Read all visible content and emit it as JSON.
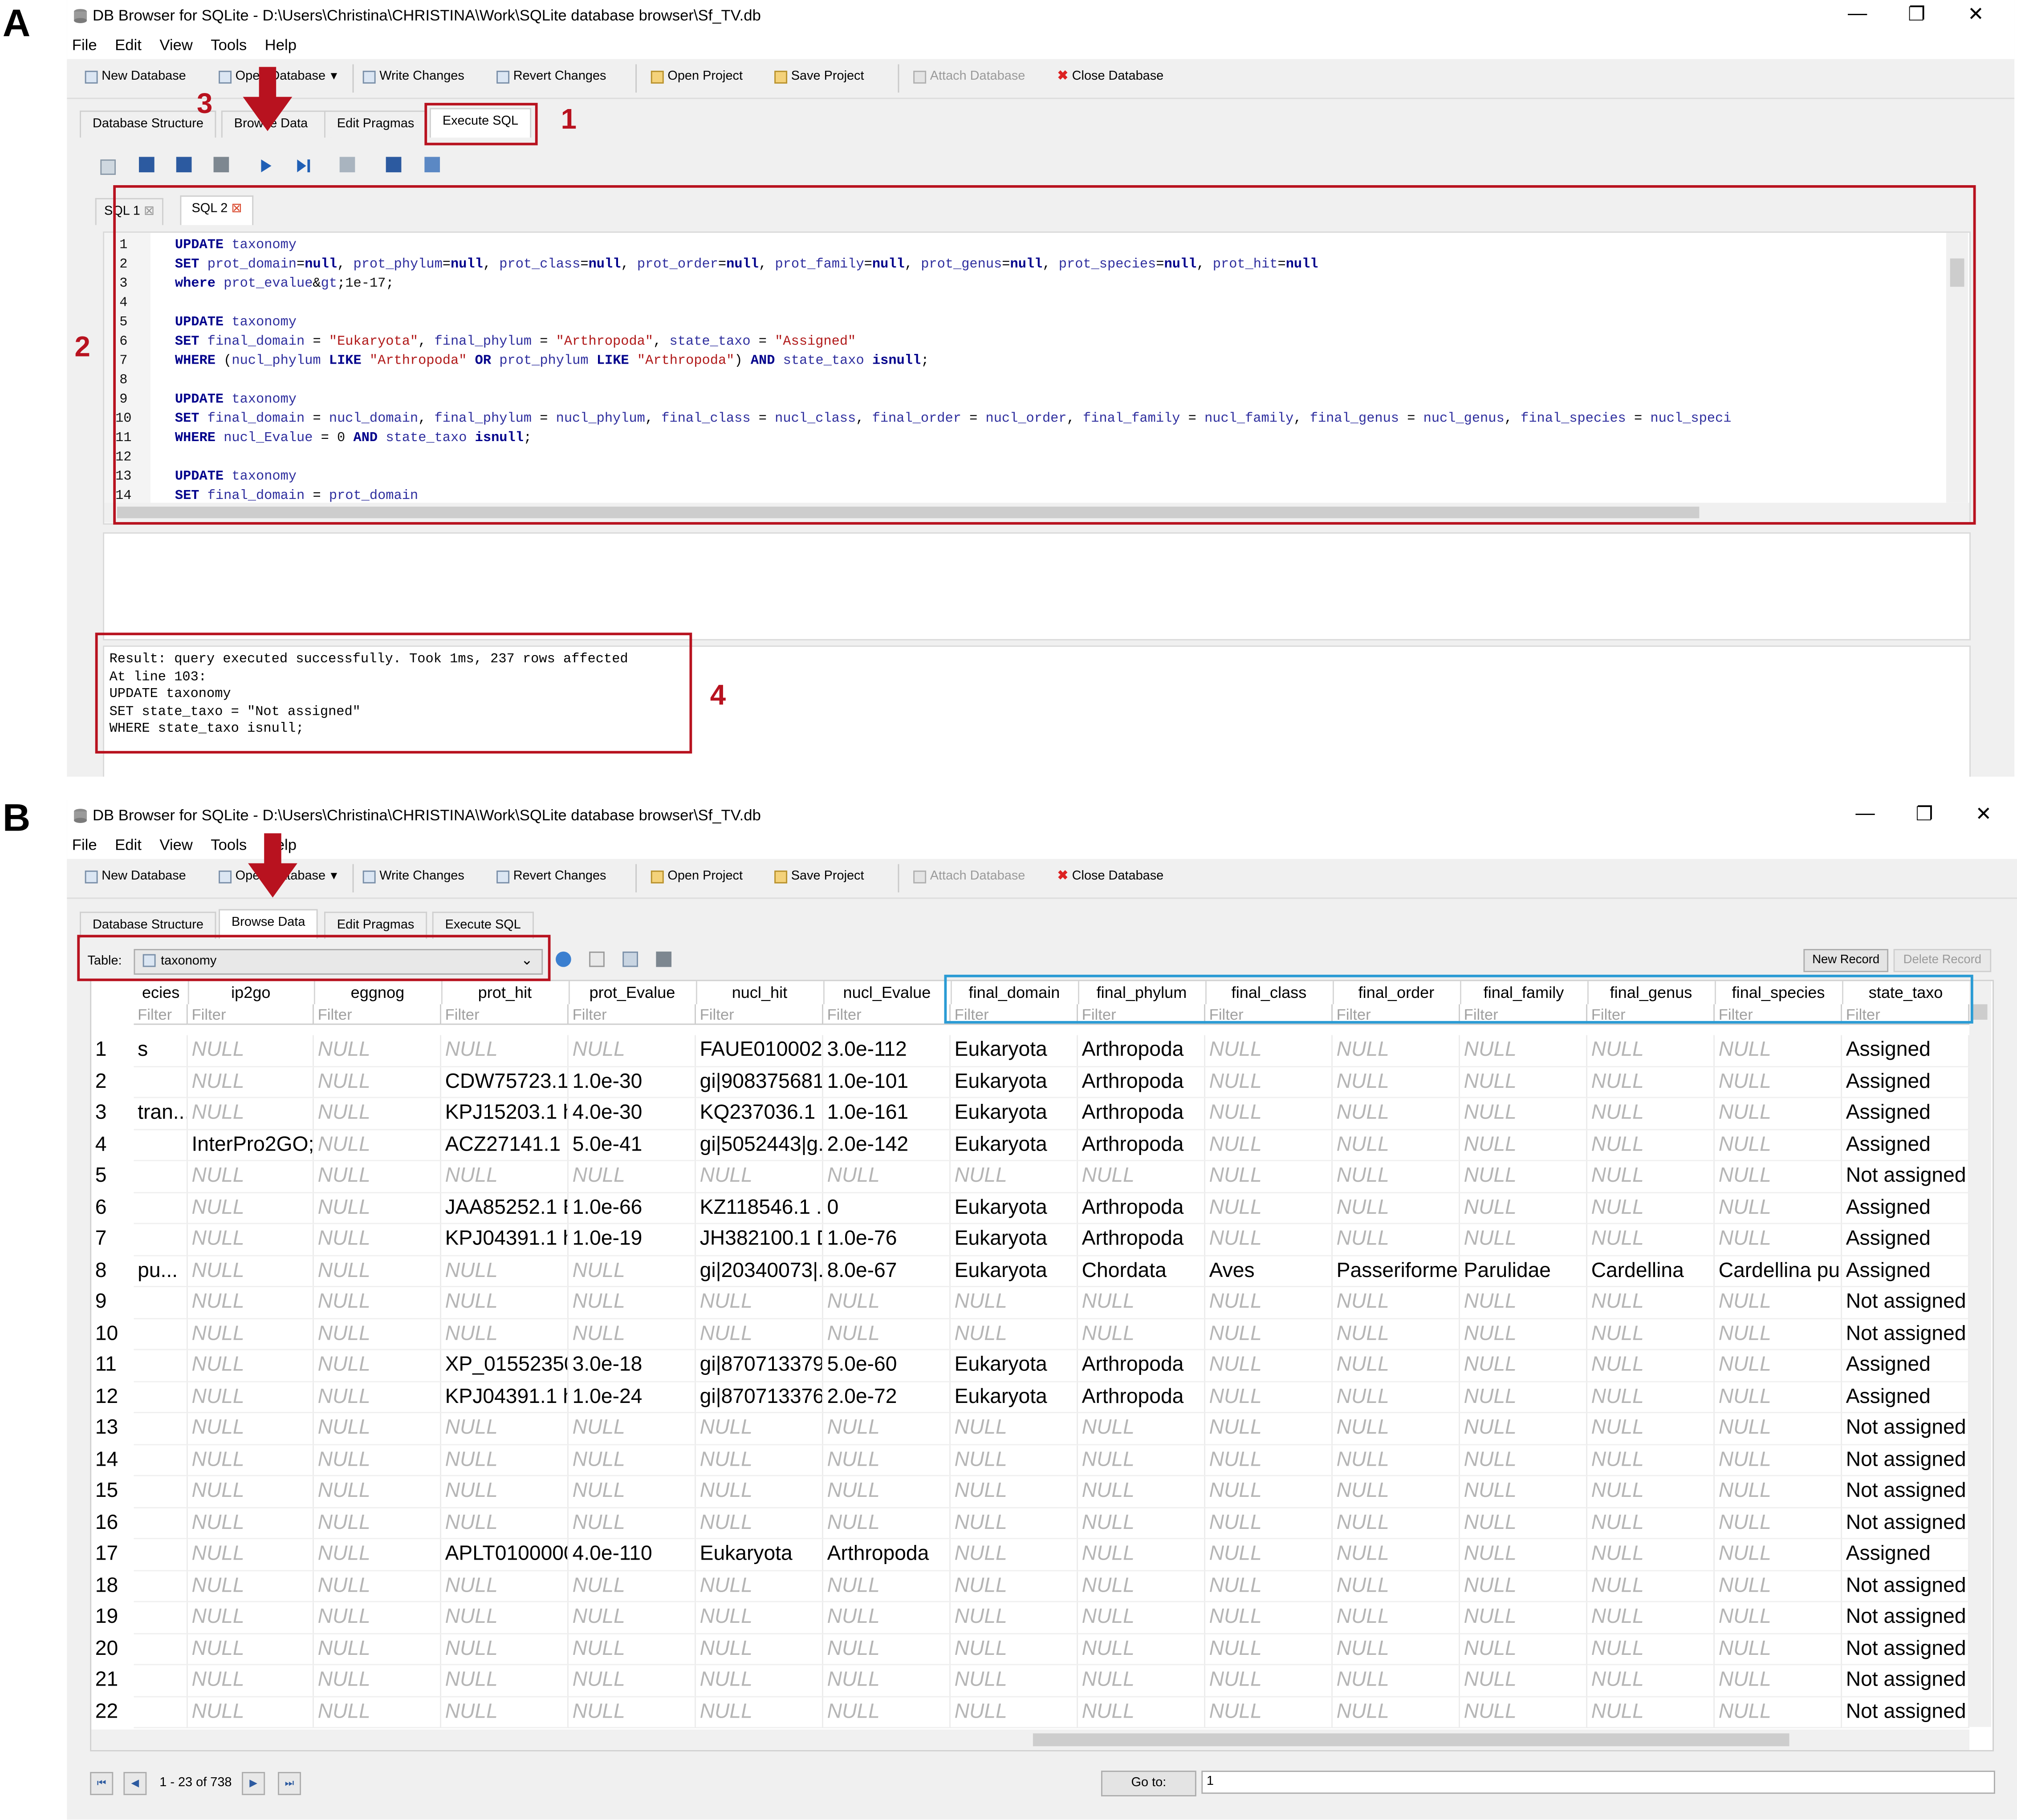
{
  "panels": {
    "a_label": "A",
    "b_label": "B"
  },
  "window": {
    "title": "DB Browser for SQLite - D:\\Users\\Christina\\CHRISTINA\\Work\\SQLite database browser\\Sf_TV.db",
    "menu": [
      "File",
      "Edit",
      "View",
      "Tools",
      "Help"
    ],
    "minimize": "—",
    "restore": "❐",
    "close": "✕"
  },
  "toolbar": {
    "new_db": "New Database",
    "open_db": "Open Database",
    "write": "Write Changes",
    "revert": "Revert Changes",
    "open_project": "Open Project",
    "save_project": "Save Project",
    "attach": "Attach Database",
    "close_db": "Close Database"
  },
  "tabs": [
    "Database Structure",
    "Browse Data",
    "Edit Pragmas",
    "Execute SQL"
  ],
  "annotations": {
    "n1": "1",
    "n2": "2",
    "n3": "3",
    "n4": "4"
  },
  "sql_tabs": [
    "SQL 1",
    "SQL 2"
  ],
  "editor_lines": [
    {
      "n": "1",
      "t": "UPDATE taxonomy"
    },
    {
      "n": "2",
      "t": "SET prot_domain=null, prot_phylum=null, prot_class=null, prot_order=null, prot_family=null, prot_genus=null, prot_species=null, prot_hit=null"
    },
    {
      "n": "3",
      "t": "where prot_evalue>1e-17;"
    },
    {
      "n": "4",
      "t": ""
    },
    {
      "n": "5",
      "t": "UPDATE taxonomy"
    },
    {
      "n": "6",
      "t": "SET final_domain = \"Eukaryota\", final_phylum = \"Arthropoda\", state_taxo = \"Assigned\""
    },
    {
      "n": "7",
      "t": "WHERE (nucl_phylum LIKE \"Arthropoda\" OR prot_phylum LIKE \"Arthropoda\") AND state_taxo isnull;"
    },
    {
      "n": "8",
      "t": ""
    },
    {
      "n": "9",
      "t": "UPDATE taxonomy"
    },
    {
      "n": "10",
      "t": "SET final_domain = nucl_domain, final_phylum = nucl_phylum, final_class = nucl_class, final_order = nucl_order,  final_family = nucl_family,  final_genus = nucl_genus, final_species = nucl_speci"
    },
    {
      "n": "11",
      "t": "WHERE nucl_Evalue = 0 AND state_taxo isnull;"
    },
    {
      "n": "12",
      "t": ""
    },
    {
      "n": "13",
      "t": "UPDATE taxonomy"
    },
    {
      "n": "14",
      "t": "SET final_domain = prot_domain"
    }
  ],
  "result_lines": [
    "Result: query executed successfully. Took 1ms, 237 rows affected",
    "At line 103:",
    "UPDATE taxonomy",
    "SET state_taxo = \"Not assigned\"",
    "WHERE state_taxo isnull;"
  ],
  "browse": {
    "table_label": "Table:",
    "table_value": "taxonomy",
    "new_record": "New Record",
    "delete_record": "Delete Record",
    "filter_placeholder": "Filter",
    "columns": [
      "ecies",
      "ip2go",
      "eggnog",
      "prot_hit",
      "prot_Evalue",
      "nucl_hit",
      "nucl_Evalue",
      "final_domain",
      "final_phylum",
      "final_class",
      "final_order",
      "final_family",
      "final_genus",
      "final_species",
      "state_taxo"
    ],
    "rows": [
      [
        "1",
        "s",
        "NULL",
        "NULL",
        "NULL",
        "NULL",
        "FAUE010002...",
        "3.0e-112",
        "Eukaryota",
        "Arthropoda",
        "NULL",
        "NULL",
        "NULL",
        "NULL",
        "NULL",
        "Assigned"
      ],
      [
        "2",
        "",
        "NULL",
        "NULL",
        "CDW75723.1 ...",
        "1.0e-30",
        "gi|908375681...",
        "1.0e-101",
        "Eukaryota",
        "Arthropoda",
        "NULL",
        "NULL",
        "NULL",
        "NULL",
        "NULL",
        "Assigned"
      ],
      [
        "3",
        "tran...",
        "NULL",
        "NULL",
        "KPJ15203.1 h...",
        "4.0e-30",
        "KQ237036.1 ...",
        "1.0e-161",
        "Eukaryota",
        "Arthropoda",
        "NULL",
        "NULL",
        "NULL",
        "NULL",
        "NULL",
        "Assigned"
      ],
      [
        "4",
        "",
        "InterPro2GO;...",
        "NULL",
        "ACZ27141.1 ...",
        "5.0e-41",
        "gi|5052443|g...",
        "2.0e-142",
        "Eukaryota",
        "Arthropoda",
        "NULL",
        "NULL",
        "NULL",
        "NULL",
        "NULL",
        "Assigned"
      ],
      [
        "5",
        "",
        "NULL",
        "NULL",
        "NULL",
        "NULL",
        "NULL",
        "NULL",
        "NULL",
        "NULL",
        "NULL",
        "NULL",
        "NULL",
        "NULL",
        "NULL",
        "Not assigned"
      ],
      [
        "6",
        "",
        "NULL",
        "NULL",
        "JAA85252.1 B...",
        "1.0e-66",
        "KZ118546.1 ...",
        "0",
        "Eukaryota",
        "Arthropoda",
        "NULL",
        "NULL",
        "NULL",
        "NULL",
        "NULL",
        "Assigned"
      ],
      [
        "7",
        "",
        "NULL",
        "NULL",
        "KPJ04391.1 h...",
        "1.0e-19",
        "JH382100.1 D...",
        "1.0e-76",
        "Eukaryota",
        "Arthropoda",
        "NULL",
        "NULL",
        "NULL",
        "NULL",
        "NULL",
        "Assigned"
      ],
      [
        "8",
        "pu...",
        "NULL",
        "NULL",
        "NULL",
        "NULL",
        "gi|20340073|...",
        "8.0e-67",
        "Eukaryota",
        "Chordata",
        "Aves",
        "Passeriformes",
        "Parulidae",
        "Cardellina",
        "Cardellina pu...",
        "Assigned"
      ],
      [
        "9",
        "",
        "NULL",
        "NULL",
        "NULL",
        "NULL",
        "NULL",
        "NULL",
        "NULL",
        "NULL",
        "NULL",
        "NULL",
        "NULL",
        "NULL",
        "NULL",
        "Not assigned"
      ],
      [
        "10",
        "",
        "NULL",
        "NULL",
        "NULL",
        "NULL",
        "NULL",
        "NULL",
        "NULL",
        "NULL",
        "NULL",
        "NULL",
        "NULL",
        "NULL",
        "NULL",
        "Not assigned"
      ],
      [
        "11",
        "",
        "NULL",
        "NULL",
        "XP_01552350...",
        "3.0e-18",
        "gi|870713379...",
        "5.0e-60",
        "Eukaryota",
        "Arthropoda",
        "NULL",
        "NULL",
        "NULL",
        "NULL",
        "NULL",
        "Assigned"
      ],
      [
        "12",
        "",
        "NULL",
        "NULL",
        "KPJ04391.1 h...",
        "1.0e-24",
        "gi|870713376...",
        "2.0e-72",
        "Eukaryota",
        "Arthropoda",
        "NULL",
        "NULL",
        "NULL",
        "NULL",
        "NULL",
        "Assigned"
      ],
      [
        "13",
        "",
        "NULL",
        "NULL",
        "NULL",
        "NULL",
        "NULL",
        "NULL",
        "NULL",
        "NULL",
        "NULL",
        "NULL",
        "NULL",
        "NULL",
        "NULL",
        "Not assigned"
      ],
      [
        "14",
        "",
        "NULL",
        "NULL",
        "NULL",
        "NULL",
        "NULL",
        "NULL",
        "NULL",
        "NULL",
        "NULL",
        "NULL",
        "NULL",
        "NULL",
        "NULL",
        "Not assigned"
      ],
      [
        "15",
        "",
        "NULL",
        "NULL",
        "NULL",
        "NULL",
        "NULL",
        "NULL",
        "NULL",
        "NULL",
        "NULL",
        "NULL",
        "NULL",
        "NULL",
        "NULL",
        "Not assigned"
      ],
      [
        "16",
        "",
        "NULL",
        "NULL",
        "NULL",
        "NULL",
        "NULL",
        "NULL",
        "NULL",
        "NULL",
        "NULL",
        "NULL",
        "NULL",
        "NULL",
        "NULL",
        "Not assigned"
      ],
      [
        "17",
        "",
        "NULL",
        "NULL",
        "APLT0100000...",
        "4.0e-110",
        "Eukaryota",
        "Arthropoda",
        "NULL",
        "NULL",
        "NULL",
        "NULL",
        "NULL",
        "NULL",
        "NULL",
        "Assigned"
      ],
      [
        "18",
        "",
        "NULL",
        "NULL",
        "NULL",
        "NULL",
        "NULL",
        "NULL",
        "NULL",
        "NULL",
        "NULL",
        "NULL",
        "NULL",
        "NULL",
        "NULL",
        "Not assigned"
      ],
      [
        "19",
        "",
        "NULL",
        "NULL",
        "NULL",
        "NULL",
        "NULL",
        "NULL",
        "NULL",
        "NULL",
        "NULL",
        "NULL",
        "NULL",
        "NULL",
        "NULL",
        "Not assigned"
      ],
      [
        "20",
        "",
        "NULL",
        "NULL",
        "NULL",
        "NULL",
        "NULL",
        "NULL",
        "NULL",
        "NULL",
        "NULL",
        "NULL",
        "NULL",
        "NULL",
        "NULL",
        "Not assigned"
      ],
      [
        "21",
        "",
        "NULL",
        "NULL",
        "NULL",
        "NULL",
        "NULL",
        "NULL",
        "NULL",
        "NULL",
        "NULL",
        "NULL",
        "NULL",
        "NULL",
        "NULL",
        "Not assigned"
      ],
      [
        "22",
        "",
        "NULL",
        "NULL",
        "NULL",
        "NULL",
        "NULL",
        "NULL",
        "NULL",
        "NULL",
        "NULL",
        "NULL",
        "NULL",
        "NULL",
        "NULL",
        "Not assigned"
      ]
    ],
    "page_info": "1 - 23 of 738",
    "goto_label": "Go to:",
    "goto_value": "1"
  },
  "colors": {
    "annotation_red": "#b8121f",
    "highlight_blue": "#2a9bd4",
    "keyword_blue": "#00008b"
  }
}
